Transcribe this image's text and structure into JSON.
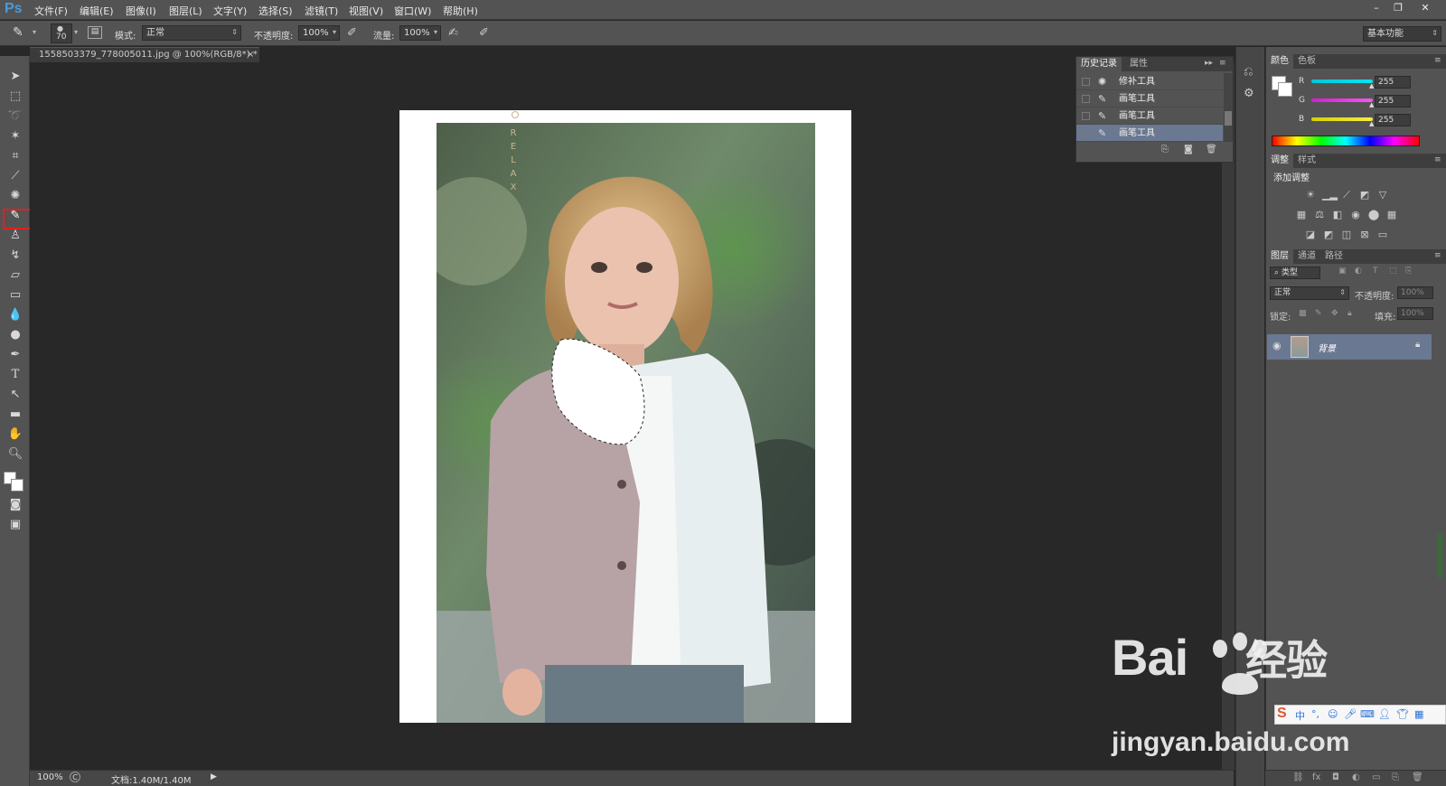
{
  "app": {
    "logo": "Ps",
    "menu": [
      "文件(F)",
      "编辑(E)",
      "图像(I)",
      "图层(L)",
      "文字(Y)",
      "选择(S)",
      "滤镜(T)",
      "视图(V)",
      "窗口(W)",
      "帮助(H)"
    ],
    "window_controls": [
      "–",
      "❐",
      "✕"
    ]
  },
  "options_bar": {
    "brush_size": "70",
    "mode_label": "模式:",
    "mode_value": "正常",
    "opacity_label": "不透明度:",
    "opacity_value": "100%",
    "flow_label": "流量:",
    "flow_value": "100%",
    "workspace": "基本功能"
  },
  "document": {
    "tab_title": "1558503379_778005011.jpg @ 100%(RGB/8*) *",
    "tab_close": "×",
    "photo_text": "RELAX"
  },
  "status": {
    "zoom": "100%",
    "doc_info": "文档:1.40M/1.40M"
  },
  "history_panel": {
    "tabs": [
      "历史记录",
      "属性"
    ],
    "items": [
      {
        "icon": "patch-icon",
        "label": "修补工具",
        "selected": false
      },
      {
        "icon": "brush-icon",
        "label": "画笔工具",
        "selected": false
      },
      {
        "icon": "brush-icon",
        "label": "画笔工具",
        "selected": false
      },
      {
        "icon": "brush-icon",
        "label": "画笔工具",
        "selected": true
      }
    ]
  },
  "color_panel": {
    "tabs": [
      "颜色",
      "色板"
    ],
    "channels": [
      {
        "name": "R",
        "value": "255",
        "color": "#00d8e8"
      },
      {
        "name": "G",
        "value": "255",
        "color": "#e020d8"
      },
      {
        "name": "B",
        "value": "255",
        "color": "#e8e000"
      }
    ]
  },
  "adjustments_panel": {
    "tabs": [
      "调整",
      "样式"
    ],
    "title": "添加调整"
  },
  "layers_panel": {
    "tabs": [
      "图层",
      "通道",
      "路径"
    ],
    "filter_label": "类型",
    "blend_mode": "正常",
    "opacity_label": "不透明度:",
    "opacity_value": "100%",
    "lock_label": "锁定:",
    "fill_label": "填充:",
    "fill_value": "100%",
    "layers": [
      {
        "name": "背景",
        "visible": true,
        "locked": true
      }
    ]
  },
  "watermark": {
    "brand": "Bai",
    "brand_suffix": "经验",
    "url": "jingyan.baidu.com"
  },
  "colors": {
    "ui_bg": "#535353",
    "canvas_bg": "#282828",
    "selection_highlight": "#6a7891",
    "callout": "#e02020",
    "ps_blue": "#4a9ad8"
  }
}
